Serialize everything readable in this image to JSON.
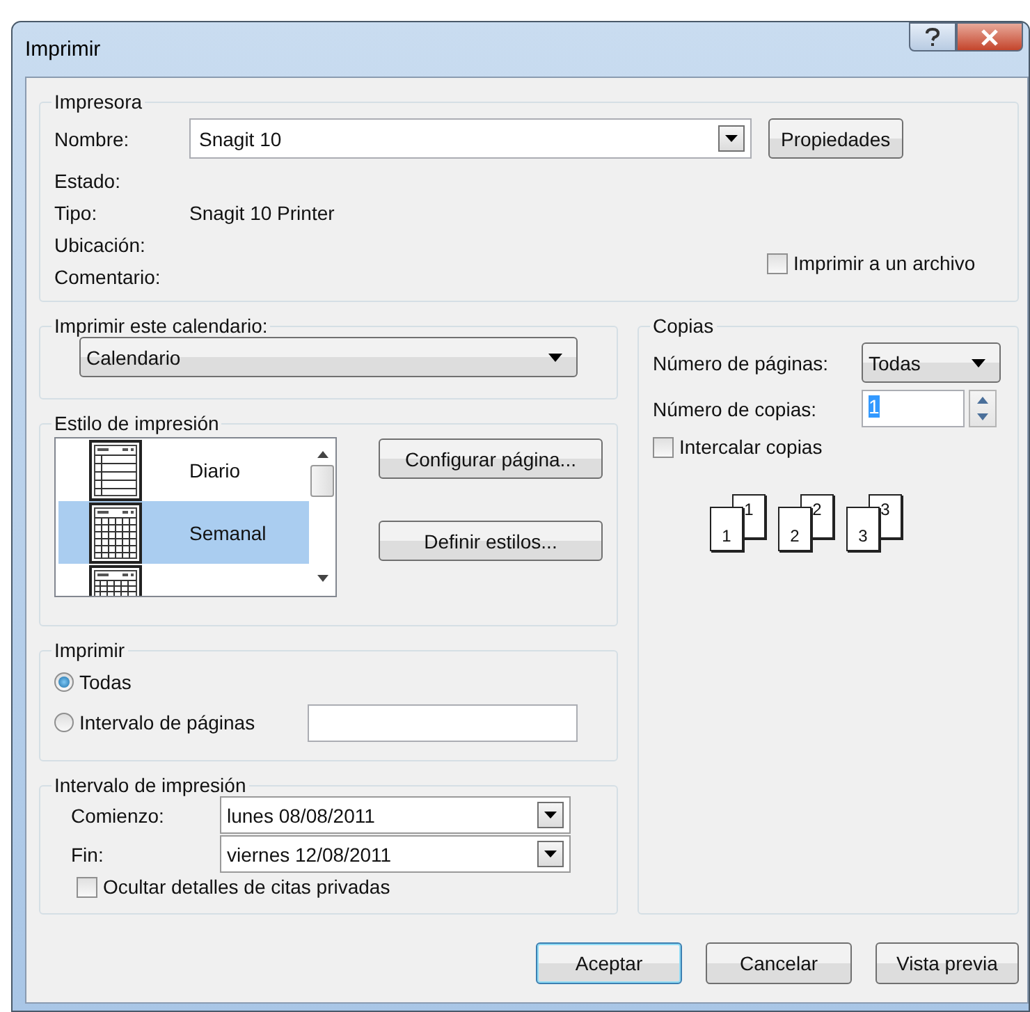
{
  "window": {
    "title": "Imprimir"
  },
  "printer": {
    "legend": "Impresora",
    "name_label": "Nombre:",
    "name_value": "Snagit 10",
    "properties_button": "Propiedades",
    "status_label": "Estado:",
    "type_label": "Tipo:",
    "type_value": "Snagit 10 Printer",
    "location_label": "Ubicación:",
    "comment_label": "Comentario:",
    "print_to_file": {
      "label": "Imprimir a un archivo",
      "checked": false
    }
  },
  "calendar": {
    "legend": "Imprimir este calendario:",
    "value": "Calendario"
  },
  "print_style": {
    "legend": "Estilo de impresión",
    "items": [
      {
        "kind": "daily",
        "label": "Diario",
        "selected": false
      },
      {
        "kind": "weekly",
        "label": "Semanal",
        "selected": true
      },
      {
        "kind": "monthly",
        "selected": false
      }
    ],
    "buttons": [
      "Configurar página...",
      "Definir estilos..."
    ]
  },
  "print": {
    "legend": "Imprimir",
    "options": [
      {
        "label": "Todas",
        "selected": true
      },
      {
        "label": "Intervalo de páginas",
        "selected": false
      }
    ]
  },
  "range": {
    "legend": "Intervalo de impresión",
    "start_label": "Comienzo:",
    "start_value": "lunes 08/08/2011",
    "end_label": "Fin:",
    "end_value": "viernes 12/08/2011",
    "hide_private": {
      "label": "Ocultar detalles de citas privadas",
      "checked": false
    }
  },
  "copies": {
    "legend": "Copias",
    "pages_label": "Número de páginas:",
    "pages_value": "Todas",
    "copies_label": "Número de copias:",
    "copies_value": "1",
    "copies_value_selected": true,
    "collate": {
      "label": "Intercalar copias",
      "checked": false
    },
    "collate_sets": [
      {
        "back": "1",
        "front": "1"
      },
      {
        "back": "2",
        "front": "2"
      },
      {
        "back": "3",
        "front": "3"
      }
    ]
  },
  "buttons": [
    {
      "label": "Aceptar",
      "default": true
    },
    {
      "label": "Cancelar",
      "default": false
    },
    {
      "label": "Vista previa",
      "default": false
    }
  ]
}
